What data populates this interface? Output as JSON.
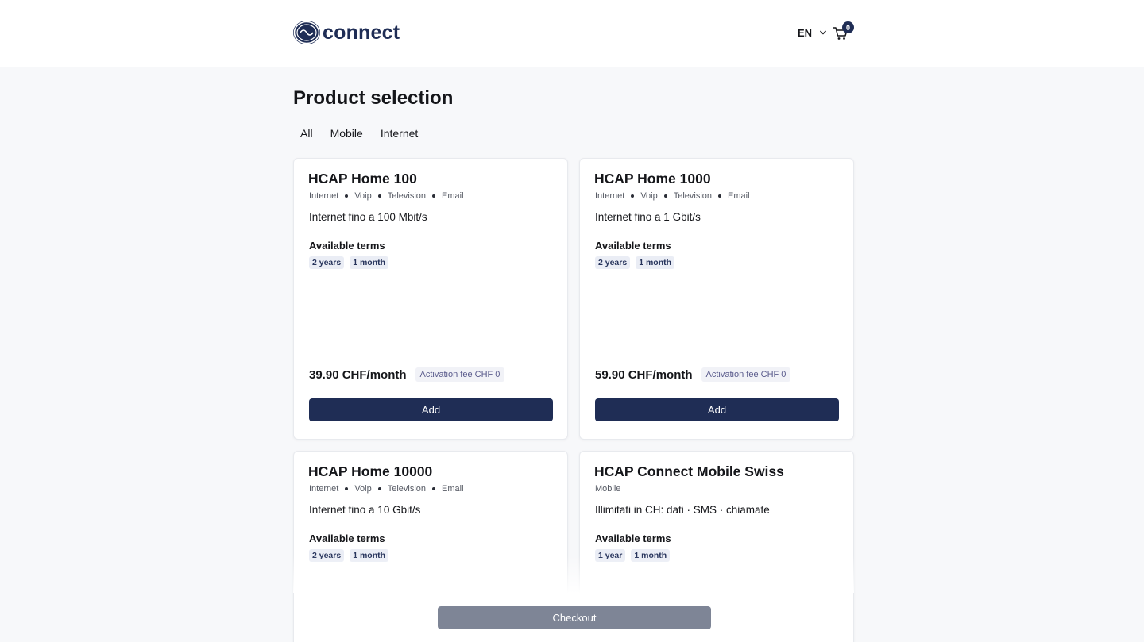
{
  "header": {
    "logo_text": "connect",
    "language": "EN",
    "cart_count": "0"
  },
  "page": {
    "title": "Product selection"
  },
  "filters": [
    "All",
    "Mobile",
    "Internet"
  ],
  "products": [
    {
      "title": "HCAP Home 100",
      "categories": [
        "Internet",
        "Voip",
        "Television",
        "Email"
      ],
      "description": "Internet fino a 100 Mbit/s",
      "terms_title": "Available terms",
      "terms": [
        "2 years",
        "1 month"
      ],
      "price": "39.90 CHF/month",
      "fee": "Activation fee CHF 0",
      "add_label": "Add"
    },
    {
      "title": "HCAP Home 1000",
      "categories": [
        "Internet",
        "Voip",
        "Television",
        "Email"
      ],
      "description": "Internet fino a 1 Gbit/s",
      "terms_title": "Available terms",
      "terms": [
        "2 years",
        "1 month"
      ],
      "price": "59.90 CHF/month",
      "fee": "Activation fee CHF 0",
      "add_label": "Add"
    },
    {
      "title": "HCAP Home 10000",
      "categories": [
        "Internet",
        "Voip",
        "Television",
        "Email"
      ],
      "description": "Internet fino a 10 Gbit/s",
      "terms_title": "Available terms",
      "terms": [
        "2 years",
        "1 month"
      ]
    },
    {
      "title": "HCAP Connect Mobile Swiss",
      "categories": [
        "Mobile"
      ],
      "description": "Illimitati in CH: dati · SMS · chiamate",
      "terms_title": "Available terms",
      "terms": [
        "1 year",
        "1 month"
      ]
    }
  ],
  "checkout": {
    "label": "Checkout"
  },
  "colors": {
    "brand": "#1f2d55",
    "checkout_disabled": "#7e8596",
    "term_chip_bg": "#eaedf5"
  }
}
